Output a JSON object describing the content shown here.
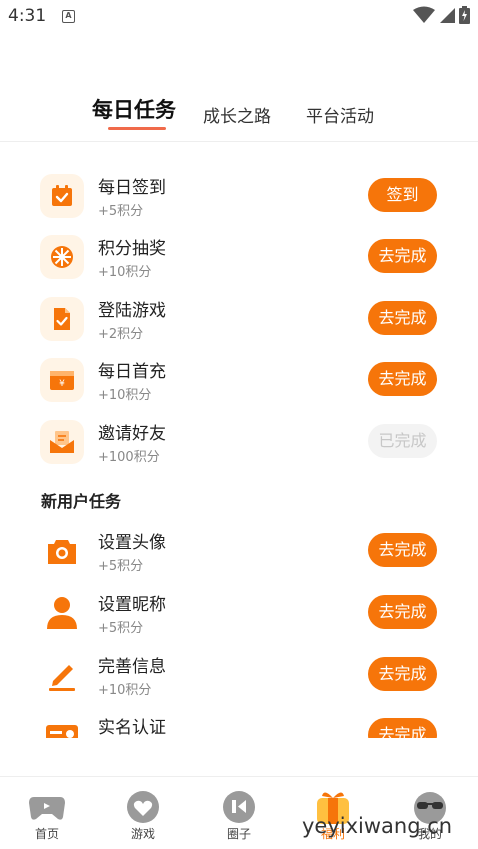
{
  "status_bar": {
    "time": "4:31",
    "notification_letter": "A"
  },
  "tabs": [
    {
      "label": "每日任务",
      "active": true
    },
    {
      "label": "成长之路",
      "active": false
    },
    {
      "label": "平台活动",
      "active": false
    }
  ],
  "daily_tasks": [
    {
      "title": "每日签到",
      "points": "+5积分",
      "button": "签到",
      "done": false,
      "icon": "calendar-check-icon"
    },
    {
      "title": "积分抽奖",
      "points": "+10积分",
      "button": "去完成",
      "done": false,
      "icon": "lottery-wheel-icon"
    },
    {
      "title": "登陆游戏",
      "points": "+2积分",
      "button": "去完成",
      "done": false,
      "icon": "document-check-icon"
    },
    {
      "title": "每日首充",
      "points": "+10积分",
      "button": "去完成",
      "done": false,
      "icon": "wallet-yen-icon"
    },
    {
      "title": "邀请好友",
      "points": "+100积分",
      "button": "已完成",
      "done": true,
      "icon": "invite-envelope-icon"
    }
  ],
  "new_user_section": {
    "title": "新用户任务",
    "tasks": [
      {
        "title": "设置头像",
        "points": "+5积分",
        "button": "去完成",
        "icon": "camera-icon"
      },
      {
        "title": "设置昵称",
        "points": "+5积分",
        "button": "去完成",
        "icon": "user-icon"
      },
      {
        "title": "完善信息",
        "points": "+10积分",
        "button": "去完成",
        "icon": "pencil-icon"
      },
      {
        "title": "实名认证",
        "points": "",
        "button": "去完成",
        "icon": "id-card-icon"
      }
    ]
  },
  "bottom_nav": [
    {
      "label": "首页",
      "icon": "gamepad-icon",
      "active": false
    },
    {
      "label": "游戏",
      "icon": "heart-bubble-icon",
      "active": false
    },
    {
      "label": "圈子",
      "icon": "chat-bubble-icon",
      "active": false
    },
    {
      "label": "福利",
      "icon": "gift-icon",
      "active": true
    },
    {
      "label": "我的",
      "icon": "sunglasses-face-icon",
      "active": false
    }
  ],
  "watermark": "yeyixiwang.cn",
  "colors": {
    "accent": "#f6750a",
    "tab_underline": "#f06a4a",
    "icon_bg": "#fff4e6",
    "done_bg": "#f3f3f3",
    "done_text": "#c7c7c7",
    "nav_icon": "#9a9a9a"
  }
}
